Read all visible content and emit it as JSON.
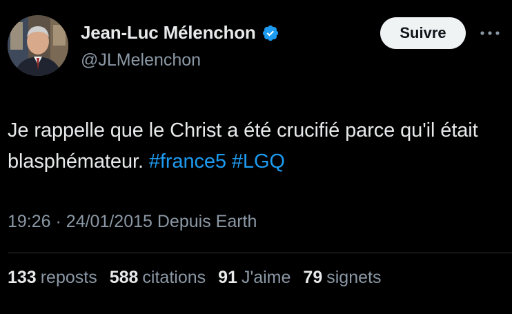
{
  "author": {
    "display_name": "Jean-Luc Mélenchon",
    "handle": "@JLMelenchon",
    "verified_icon": "verified-badge-icon",
    "verified_color": "#1d9bf0"
  },
  "header": {
    "follow_label": "Suivre",
    "more_icon": "more-dots-icon"
  },
  "tweet": {
    "text_part1": "Je rappelle que le Christ a été crucifié parce qu'il était blasphémateur.",
    "hashtag1": "#france5",
    "hashtag2": "#LGQ"
  },
  "meta": {
    "time": "19:26",
    "separator": "·",
    "date": "24/01/2015",
    "source": "Depuis Earth"
  },
  "stats": {
    "reposts_count": "133",
    "reposts_label": "reposts",
    "quotes_count": "588",
    "quotes_label": "citations",
    "likes_count": "91",
    "likes_label": "J'aime",
    "bookmarks_count": "79",
    "bookmarks_label": "signets"
  },
  "colors": {
    "background": "#000000",
    "text": "#e7e9ea",
    "secondary": "#8b98a5",
    "link": "#1d9bf0",
    "button_bg": "#eff3f4"
  }
}
